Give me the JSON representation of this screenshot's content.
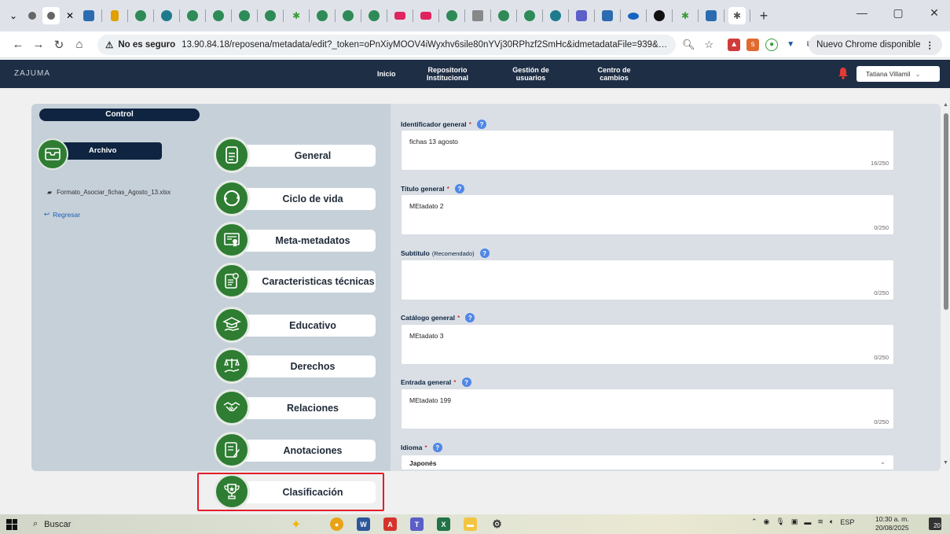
{
  "browser": {
    "address": {
      "security_label": "No es seguro",
      "url": "13.90.84.18/reposena/metadata/edit?_token=oPnXiyMOOV4iWyxhv6sile80nYVj30RPhzf2SmHc&idmetadataFile=939&pa..."
    },
    "update_label": "Nuevo Chrome disponible",
    "profile_initial": "T"
  },
  "app": {
    "logo": "ZAJUMA",
    "nav": [
      {
        "label": "Inicio"
      },
      {
        "label": "Repositorio Institucional"
      },
      {
        "label": "Gestión de usuarios"
      },
      {
        "label": "Centro de cambios"
      }
    ],
    "user": "Tatiana Villamil",
    "colors": {
      "header": "#1e2e45",
      "accent_green": "#2e7d32",
      "navy": "#0e2440",
      "highlight_red": "#e11d2b"
    }
  },
  "control": {
    "title": "Control",
    "archivo_label": "Archivo",
    "file_name": "Formato_Asociar_fichas_Agosto_13.xlsx",
    "back_label": "Regresar"
  },
  "sections": [
    {
      "label": "General",
      "icon": "document-icon"
    },
    {
      "label": "Ciclo de vida",
      "icon": "cycle-icon"
    },
    {
      "label": "Meta-metadatos",
      "icon": "certificate-icon"
    },
    {
      "label": "Caracteristicas técnicas",
      "icon": "gear-document-icon"
    },
    {
      "label": "Educativo",
      "icon": "graduation-hand-icon"
    },
    {
      "label": "Derechos",
      "icon": "scales-hand-icon"
    },
    {
      "label": "Relaciones",
      "icon": "handshake-icon"
    },
    {
      "label": "Anotaciones",
      "icon": "notes-icon"
    },
    {
      "label": "Clasificación",
      "icon": "trophy-icon"
    }
  ],
  "form": {
    "identificador": {
      "label": "Identificador general",
      "value": "fichas 13 agosto",
      "counter": "16/250"
    },
    "titulo": {
      "label": "Titulo general",
      "value": "MEtadato 2",
      "counter": "0/250"
    },
    "subtitulo": {
      "label": "Subtitulo",
      "note": "(Recomendado)",
      "value": "",
      "counter": "0/250"
    },
    "catalogo": {
      "label": "Catálogo general",
      "value": "MEtadato 3",
      "counter": "0/250"
    },
    "entrada": {
      "label": "Entrada general",
      "value": "MEtadato 199",
      "counter": "0/250"
    },
    "idioma": {
      "label": "Idioma",
      "value": "Japonés"
    }
  },
  "taskbar": {
    "search_label": "Buscar",
    "lang": "ESP",
    "time": "10:30 a. m.",
    "date": "20/08/2025",
    "notif_count": "20"
  }
}
